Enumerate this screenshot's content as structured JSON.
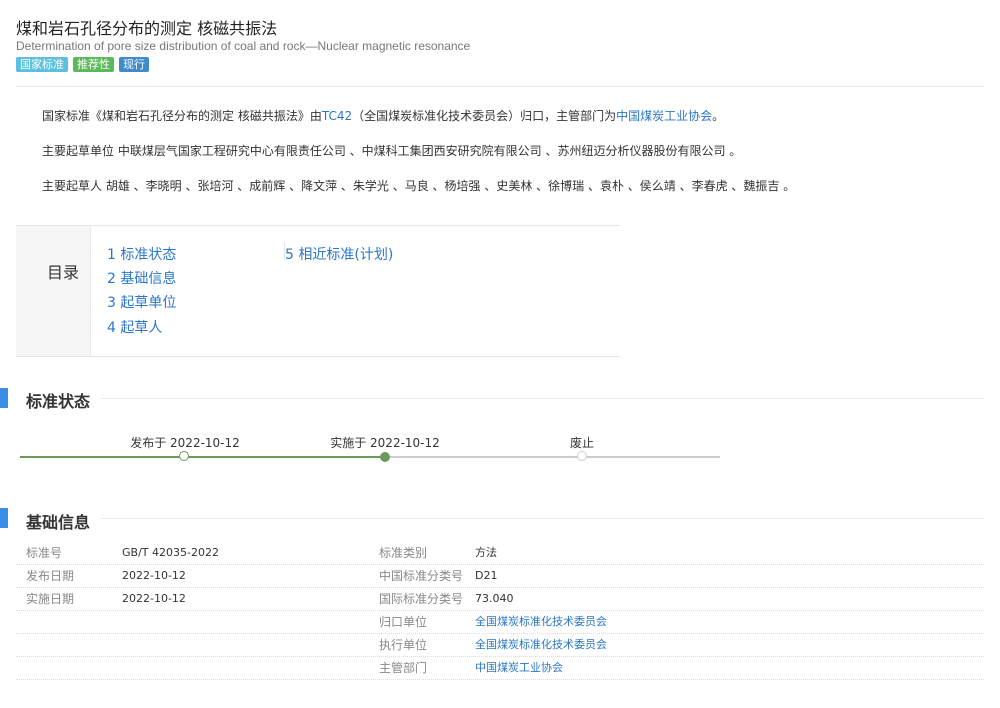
{
  "header": {
    "title": "煤和岩石孔径分布的测定 核磁共振法",
    "subtitle": "Determination of pore size distribution of coal and rock—Nuclear magnetic resonance",
    "badges": [
      "国家标准",
      "推荐性",
      "现行"
    ]
  },
  "intro": {
    "p1_prefix": "国家标准《煤和岩石孔径分布的测定 核磁共振法》由",
    "p1_tc_link": "TC42",
    "p1_mid": "（全国煤炭标准化技术委员会）归口，主管部门为",
    "p1_dept_link": "中国煤炭工业协会",
    "p1_suffix": "。",
    "p2": "主要起草单位 中联煤层气国家工程研究中心有限责任公司 、中煤科工集团西安研究院有限公司 、苏州纽迈分析仪器股份有限公司 。",
    "p3": "主要起草人 胡雄 、李晓明 、张培河 、成前辉 、降文萍 、朱学光 、马良 、杨培强 、史美林 、徐博瑞 、袁朴 、侯么靖 、李春虎 、魏振吉 。"
  },
  "toc": {
    "title": "目录",
    "items": [
      "1 标准状态",
      "2 基础信息",
      "3 起草单位",
      "4 起草人",
      "5 相近标准(计划)"
    ]
  },
  "status_section": {
    "title": "标准状态",
    "steps": [
      {
        "label": "发布于 2022-10-12",
        "state": "done"
      },
      {
        "label": "实施于 2022-10-12",
        "state": "current"
      },
      {
        "label": "废止",
        "state": "pending"
      }
    ],
    "colors": {
      "active": "#6a9a5a",
      "inactive": "#cccccc"
    }
  },
  "basic_section": {
    "title": "基础信息",
    "left": [
      {
        "label": "标准号",
        "value": "GB/T 42035-2022"
      },
      {
        "label": "发布日期",
        "value": "2022-10-12"
      },
      {
        "label": "实施日期",
        "value": "2022-10-12"
      }
    ],
    "right": [
      {
        "label": "标准类别",
        "value": "方法",
        "link": false
      },
      {
        "label": "中国标准分类号",
        "value": "D21",
        "link": false
      },
      {
        "label": "国际标准分类号",
        "value": "73.040",
        "link": false
      },
      {
        "label": "归口单位",
        "value": "全国煤炭标准化技术委员会",
        "link": true
      },
      {
        "label": "执行单位",
        "value": "全国煤炭标准化技术委员会",
        "link": true
      },
      {
        "label": "主管部门",
        "value": "中国煤炭工业协会",
        "link": true
      }
    ]
  }
}
